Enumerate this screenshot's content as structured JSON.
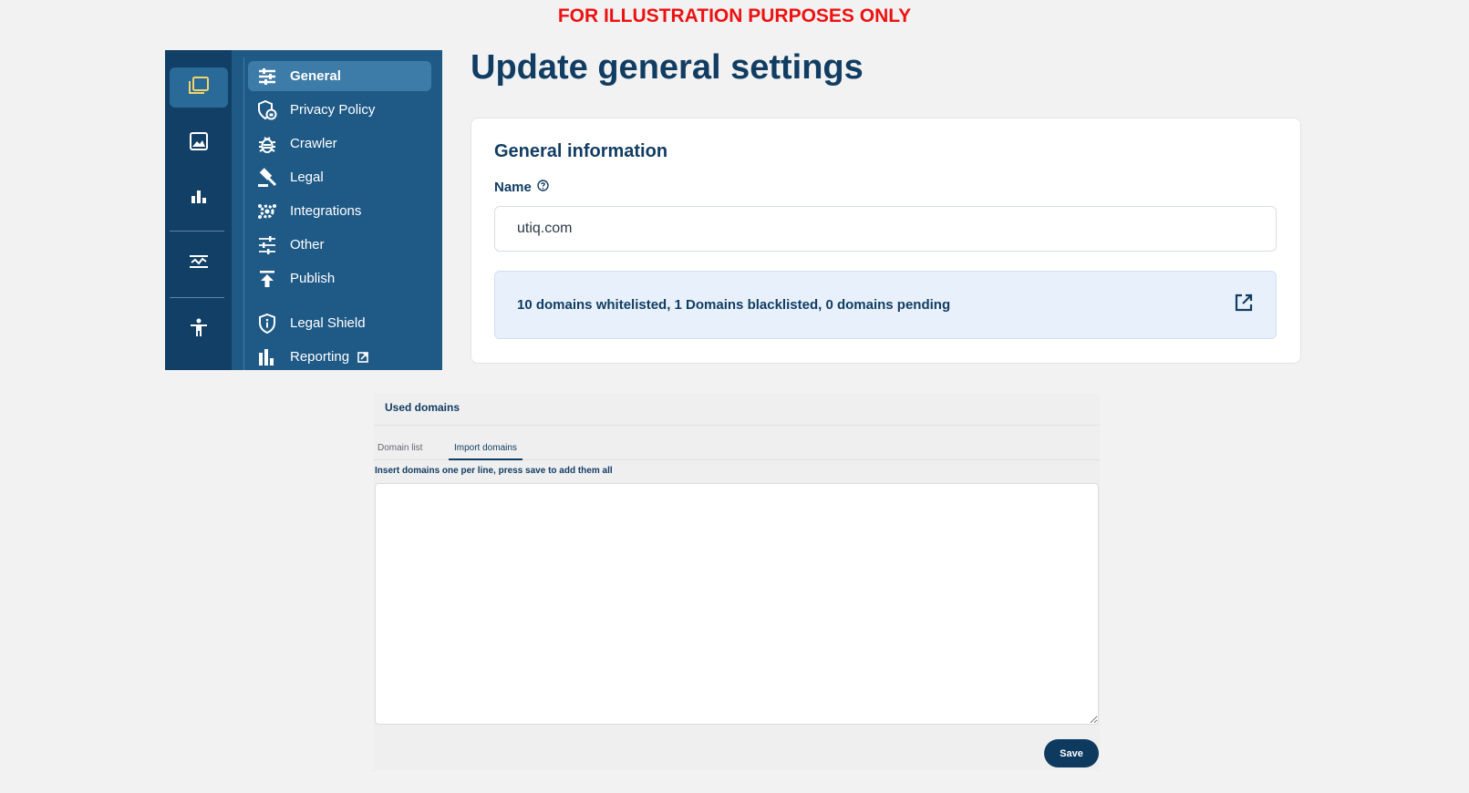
{
  "banner": "FOR ILLUSTRATION PURPOSES ONLY",
  "colors": {
    "rail": "#113f66",
    "sidebar": "#1f5a87",
    "title": "#123d63",
    "accent_icon": "#f2d46b",
    "banner": "#ee1111"
  },
  "rail": {
    "items": [
      {
        "icon": "folders-icon",
        "active": true
      },
      {
        "icon": "image-icon",
        "active": false
      },
      {
        "icon": "bar-chart-icon",
        "active": false
      },
      {
        "icon": "settings-sliders-icon",
        "active": false
      },
      {
        "icon": "accessibility-icon",
        "active": false
      }
    ]
  },
  "sidebar": {
    "items": [
      {
        "label": "General",
        "icon": "sliders-icon",
        "active": true
      },
      {
        "label": "Privacy Policy",
        "icon": "privacy-shield-icon"
      },
      {
        "label": "Crawler",
        "icon": "bug-icon"
      },
      {
        "label": "Legal",
        "icon": "gavel-icon"
      },
      {
        "label": "Integrations",
        "icon": "integrations-gear-icon"
      },
      {
        "label": "Other",
        "icon": "tune-icon"
      },
      {
        "label": "Publish",
        "icon": "publish-icon"
      },
      {
        "label": "Legal Shield",
        "icon": "shield-info-icon"
      },
      {
        "label": "Reporting",
        "icon": "report-chart-icon",
        "external_icon": "external-link-icon"
      }
    ]
  },
  "main": {
    "title": "Update general settings",
    "card": {
      "title": "General information",
      "name_label": "Name",
      "name_value": "utiq.com",
      "domains_summary": "10 domains whitelisted, 1 Domains blacklisted, 0 domains pending"
    }
  },
  "used_domains": {
    "title": "Used domains",
    "tabs": [
      {
        "label": "Domain list",
        "active": false
      },
      {
        "label": "Import domains",
        "active": true
      }
    ],
    "hint": "Insert domains one per line, press save to add them all",
    "textarea_value": "",
    "save_label": "Save"
  }
}
